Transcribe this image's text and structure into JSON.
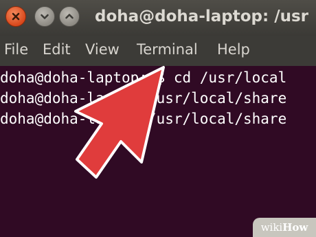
{
  "window": {
    "title": "doha@doha-laptop: /usr",
    "buttons": {
      "close_icon": "close-icon",
      "minimize_icon": "chevron-down-icon",
      "maximize_icon": "chevron-up-icon"
    }
  },
  "menu": {
    "items": [
      {
        "label": "File"
      },
      {
        "label": "Edit"
      },
      {
        "label": "View"
      },
      {
        "label": "Terminal"
      },
      {
        "label": "Help"
      }
    ]
  },
  "terminal": {
    "lines": [
      "doha@doha-laptop:~$ cd /usr/local",
      "doha@doha-laptop:/usr/local/share",
      "doha@doha-laptop:/usr/local/share"
    ],
    "background": "#300a24",
    "text_color": "#ffffff"
  },
  "overlay": {
    "arrow_color": "#e03c3c"
  },
  "watermark": {
    "prefix": "wiki",
    "suffix": "How"
  }
}
